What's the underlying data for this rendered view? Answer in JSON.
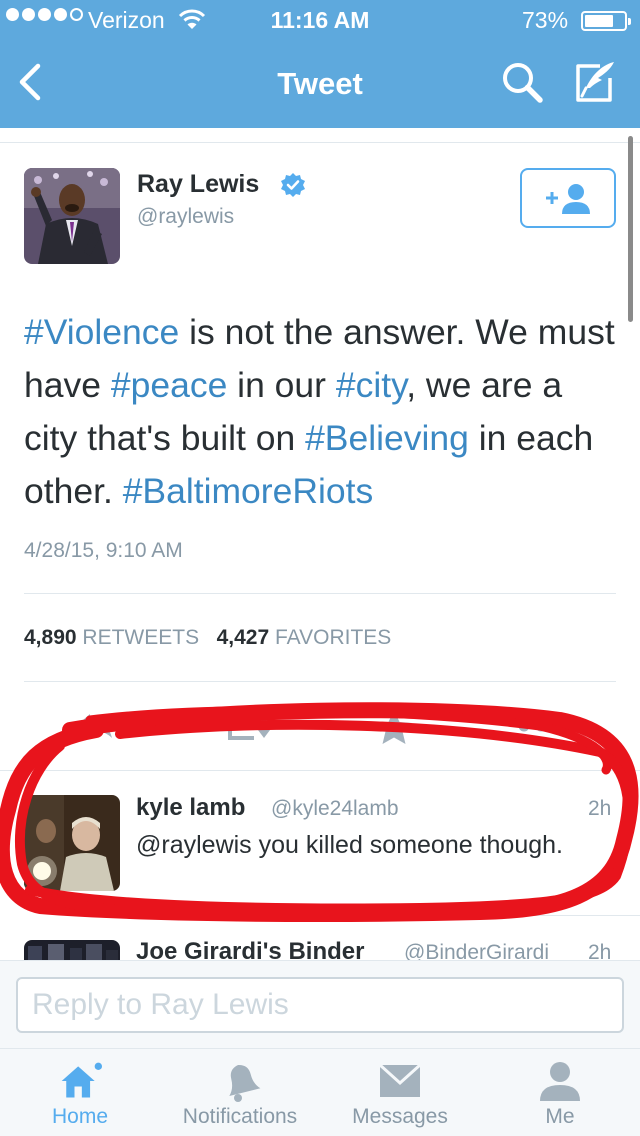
{
  "status_bar": {
    "carrier": "Verizon",
    "time": "11:16 AM",
    "battery_percent_text": "73%",
    "battery_level": 0.73,
    "signal_bars": 4,
    "signal_total": 5
  },
  "nav": {
    "title": "Tweet",
    "back_icon": "chevron-left-icon",
    "search_icon": "search-icon",
    "compose_icon": "compose-icon"
  },
  "tweet": {
    "author_name": "Ray Lewis",
    "author_handle": "@raylewis",
    "verified": true,
    "follow_icon": "add-user-icon",
    "text_segments": [
      {
        "text": "#Violence",
        "hashtag": true
      },
      {
        "text": " is not the answer. We must have ",
        "hashtag": false
      },
      {
        "text": "#peace",
        "hashtag": true
      },
      {
        "text": " in our ",
        "hashtag": false
      },
      {
        "text": "#city",
        "hashtag": true
      },
      {
        "text": ", we are a city that's built on ",
        "hashtag": false
      },
      {
        "text": "#Believing",
        "hashtag": true
      },
      {
        "text": " in each other. ",
        "hashtag": false
      },
      {
        "text": "#BaltimoreRiots",
        "hashtag": true
      }
    ],
    "timestamp": "4/28/15, 9:10 AM",
    "retweets_count": "4,890",
    "retweets_label": "RETWEETS",
    "favorites_count": "4,427",
    "favorites_label": "FAVORITES",
    "actions": [
      "reply-icon",
      "retweet-icon",
      "favorite-icon",
      "more-icon"
    ]
  },
  "replies": [
    {
      "name": "kyle lamb",
      "handle": "@kyle24lamb",
      "time": "2h",
      "text": "@raylewis you killed someone though."
    },
    {
      "name": "Joe Girardi's Binder",
      "handle": "@BinderGirardi",
      "time": "2h"
    }
  ],
  "reply_box": {
    "placeholder": "Reply to Ray Lewis"
  },
  "tabs": [
    {
      "label": "Home",
      "icon": "home-icon",
      "active": true
    },
    {
      "label": "Notifications",
      "icon": "bell-icon",
      "active": false
    },
    {
      "label": "Messages",
      "icon": "envelope-icon",
      "active": false
    },
    {
      "label": "Me",
      "icon": "person-icon",
      "active": false
    }
  ],
  "colors": {
    "brand_blue": "#5ea9dd",
    "hashtag": "#3b88c3",
    "muted": "#8899a6",
    "annotation_red": "#e8141c"
  }
}
